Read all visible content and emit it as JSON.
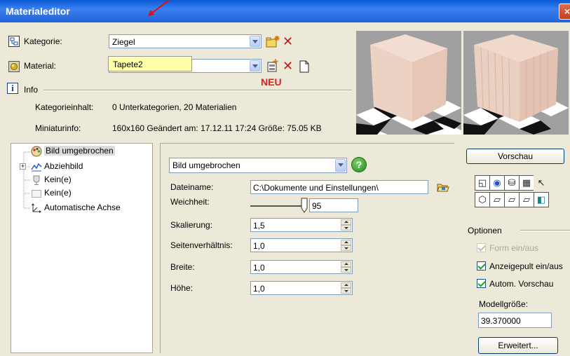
{
  "window": {
    "title": "Materialeditor",
    "close_glyph": "×"
  },
  "header": {
    "kategorie_label": "Kategorie:",
    "kategorie_value": "Ziegel",
    "material_label": "Material:",
    "material_tooltip": "Tapete2",
    "info_label": "Info",
    "neu_annotation": "NEU",
    "kategorieinhalt_label": "Kategorieinhalt:",
    "kategorieinhalt_value": "0 Unterkategorien, 20 Materialien",
    "miniaturinfo_label": "Miniaturinfo:",
    "miniaturinfo_value": "160x160  Geändert am: 17.12.11 17:24 Größe: 75.05  KB"
  },
  "tree": {
    "items": [
      {
        "label": "Bild umgebrochen",
        "icon": "palette-icon",
        "selected": true
      },
      {
        "label": "Abziehbild",
        "icon": "decal-icon",
        "expander": "+"
      },
      {
        "label": "Kein(e)",
        "icon": "cup-icon"
      },
      {
        "label": "Kein(e)",
        "icon": "blank-image-icon"
      },
      {
        "label": "Automatische Achse",
        "icon": "axis-icon"
      }
    ]
  },
  "panel": {
    "map_type": "Bild umgebrochen",
    "dateiname_label": "Dateiname:",
    "dateiname_value": "C:\\Dokumente und Einstellungen\\",
    "weichheit_label": "Weichheit:",
    "weichheit_value": "95",
    "skalierung_label": "Skalierung:",
    "skalierung_value": "1,5",
    "seitenverhaeltnis_label": "Seitenverhältnis:",
    "seitenverhaeltnis_value": "1,0",
    "breite_label": "Breite:",
    "breite_value": "1,0",
    "hoehe_label": "Höhe:",
    "hoehe_value": "1,0"
  },
  "right": {
    "vorschau_button": "Vorschau",
    "optionen_label": "Optionen",
    "form_label": "Form ein/aus",
    "form_checked": true,
    "anzeigepult_label": "Anzeigepult ein/aus",
    "anzeigepult_checked": true,
    "autovorschau_label": "Autom. Vorschau",
    "autovorschau_checked": true,
    "modellgroesse_label": "Modellgröße:",
    "modellgroesse_value": "39.370000",
    "erweitert_button": "Erweitert..."
  },
  "colors": {
    "title_bar": "#0a5bd6",
    "accent_red": "#e02020",
    "dialog_bg": "#ece9d8"
  }
}
